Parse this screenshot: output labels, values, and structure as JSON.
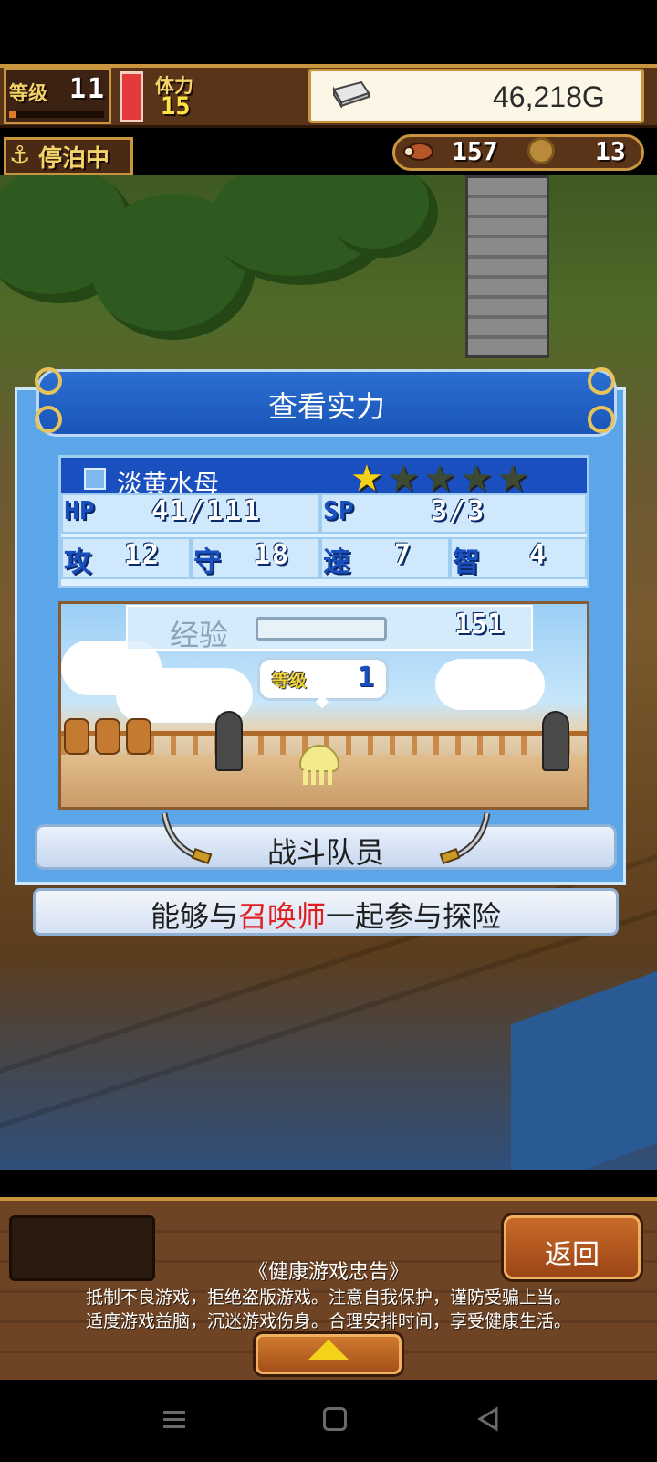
{
  "hud": {
    "level_label": "等级",
    "level_value": "11",
    "stamina_label": "体力",
    "stamina_value": "15",
    "gold": "46,218G",
    "docked_label": "停泊中",
    "food": "157",
    "medals": "13"
  },
  "dialog": {
    "title": "查看实力",
    "monster_name": "淡黄水母",
    "stars_filled": 1,
    "stars_total": 5,
    "stats": {
      "hp_label": "HP",
      "hp_value": "41/111",
      "sp_label": "SP",
      "sp_value": "3/3",
      "atk_label": "攻",
      "atk_value": "12",
      "def_label": "守",
      "def_value": "18",
      "spd_label": "速",
      "spd_value": "7",
      "int_label": "智",
      "int_value": "4"
    },
    "exp_label": "经验",
    "exp_value": "151",
    "bubble_level_label": "等级",
    "bubble_level_value": "1",
    "crew_label": "战斗队员",
    "description_before": "能够与",
    "description_highlight": "召唤师",
    "description_after": "一起参与探险"
  },
  "bottom": {
    "back_label": "返回",
    "notice_title": "《健康游戏忠告》",
    "notice_line1": "抵制不良游戏，拒绝盗版游戏。注意自我保护，谨防受骗上当。",
    "notice_line2": "适度游戏益脑，沉迷游戏伤身。合理安排时间，享受健康生活。"
  },
  "colors": {
    "accent_blue": "#1a4fc0",
    "highlight_red": "#e02020",
    "gold_frame": "#c9963f"
  },
  "icons": [
    "anchor-icon",
    "silver-bar-icon",
    "food-icon",
    "coin-icon",
    "star-icon",
    "sword-icon",
    "up-arrow-icon",
    "menu-icon",
    "home-icon",
    "back-icon"
  ]
}
